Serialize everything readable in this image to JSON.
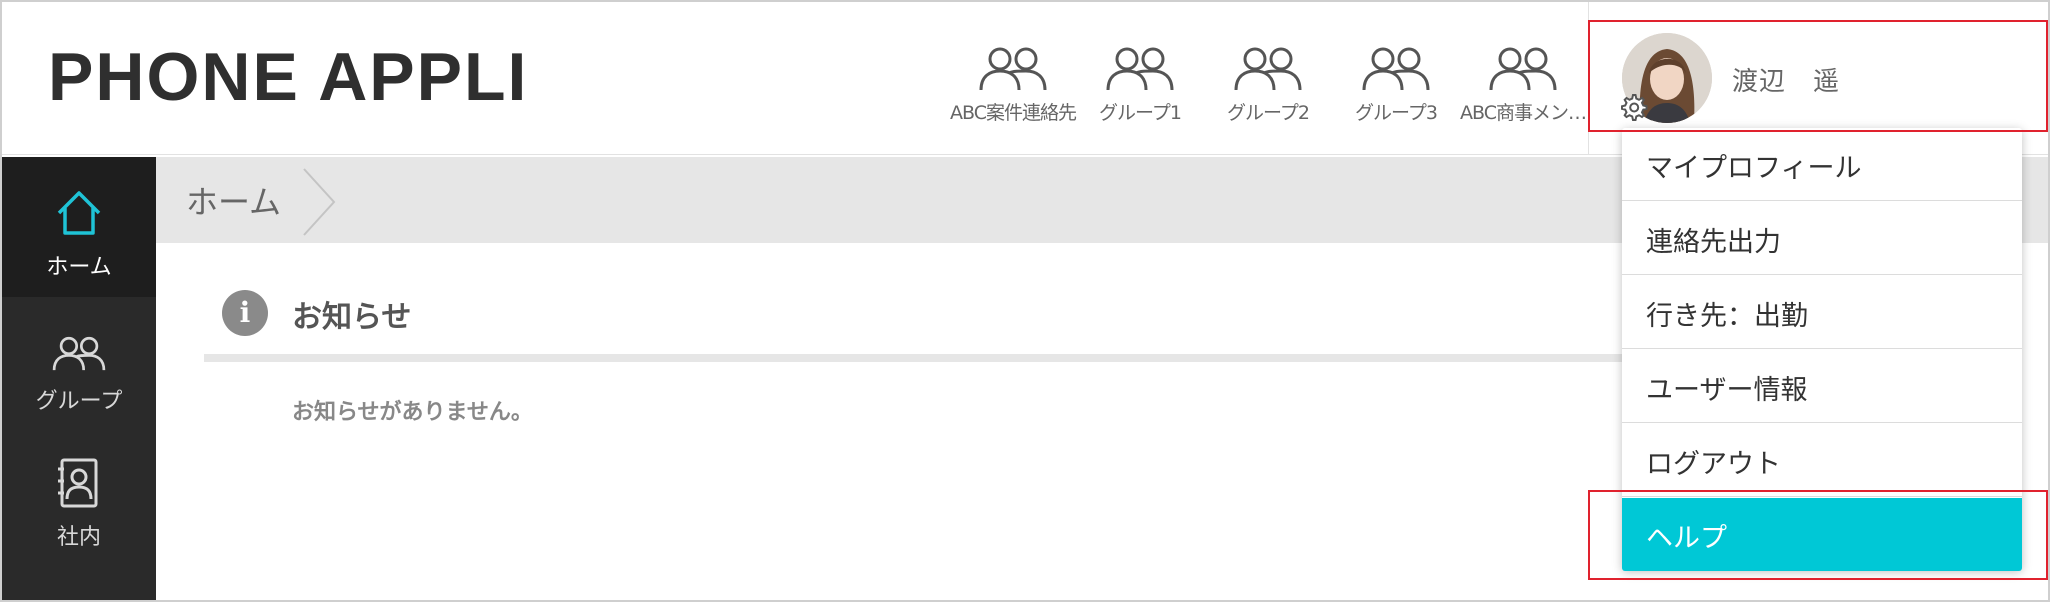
{
  "header": {
    "logo": "PHONE APPLI",
    "groups": [
      {
        "label": "ABC案件連絡先"
      },
      {
        "label": "グループ1"
      },
      {
        "label": "グループ2"
      },
      {
        "label": "グループ3"
      },
      {
        "label": "ABC商事メン…"
      }
    ],
    "user_name": "渡辺　遥"
  },
  "sidebar": {
    "items": [
      {
        "label": "ホーム",
        "icon": "home-icon",
        "active": true
      },
      {
        "label": "グループ",
        "icon": "group-icon",
        "active": false
      },
      {
        "label": "社内",
        "icon": "contact-book-icon",
        "active": false
      }
    ]
  },
  "breadcrumb": {
    "home": "ホーム"
  },
  "notice": {
    "title": "お知らせ",
    "empty_message": "お知らせがありません。",
    "info_glyph": "i"
  },
  "user_menu": {
    "items": [
      {
        "label": "マイプロフィール"
      },
      {
        "label": "連絡先出力"
      },
      {
        "label": "行き先：出勤"
      },
      {
        "label": "ユーザー情報"
      },
      {
        "label": "ログアウト"
      },
      {
        "label": "ヘルプ"
      }
    ]
  },
  "colors": {
    "accent": "#00c8d6",
    "sidebar_bg": "#2a2a2a",
    "highlight": "#e0222e",
    "home_icon": "#1fc3d6"
  }
}
